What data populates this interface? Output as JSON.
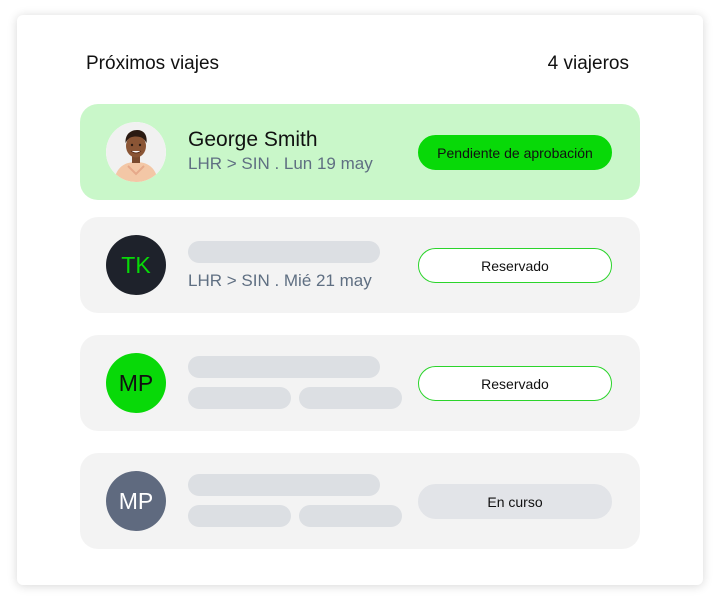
{
  "header": {
    "title": "Próximos viajes",
    "count": "4 viajeros"
  },
  "colors": {
    "highlight_row": "#c9f7c9",
    "accent_green": "#08d908",
    "dark_avatar": "#1e222b",
    "slate_avatar": "#5f6a7f",
    "skeleton": "#dcdfe3"
  },
  "trips": [
    {
      "traveler_name": "George Smith",
      "route": "LHR > SIN . Lun 19 may",
      "status": "Pendiente de aprobación",
      "avatar": "photo"
    },
    {
      "initials": "TK",
      "route": "LHR > SIN . Mié 21 may",
      "status": "Reservado"
    },
    {
      "initials": "MP",
      "status": "Reservado"
    },
    {
      "initials": "MP",
      "status": "En curso"
    }
  ]
}
